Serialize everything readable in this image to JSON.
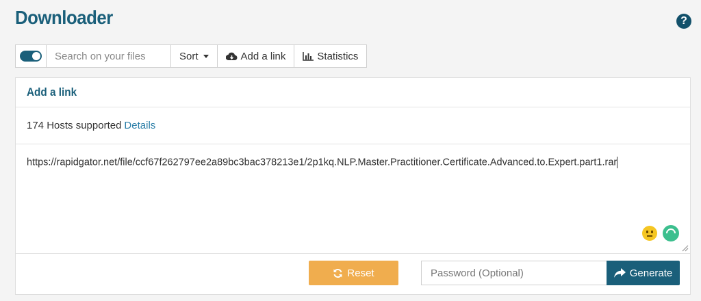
{
  "header": {
    "title": "Downloader",
    "help_icon": "question-circle-icon"
  },
  "toolbar": {
    "toggle_state": "on",
    "search_placeholder": "Search on your files",
    "search_value": "",
    "sort_label": "Sort",
    "add_link_label": "Add a link",
    "statistics_label": "Statistics"
  },
  "panel": {
    "title": "Add a link",
    "hosts_text": "174 Hosts supported",
    "details_label": "Details",
    "link_value": "https://rapidgator.net/file/ccf67f262797ee2a89bc3bac378213e1/2p1kq.NLP.Master.Practitioner.Certificate.Advanced.to.Expert.part1.rar",
    "reset_label": "Reset",
    "password_placeholder": "Password (Optional)",
    "generate_label": "Generate"
  },
  "colors": {
    "brand": "#1a5f7a",
    "reset": "#f0ad4e",
    "link": "#2c7fa8"
  }
}
